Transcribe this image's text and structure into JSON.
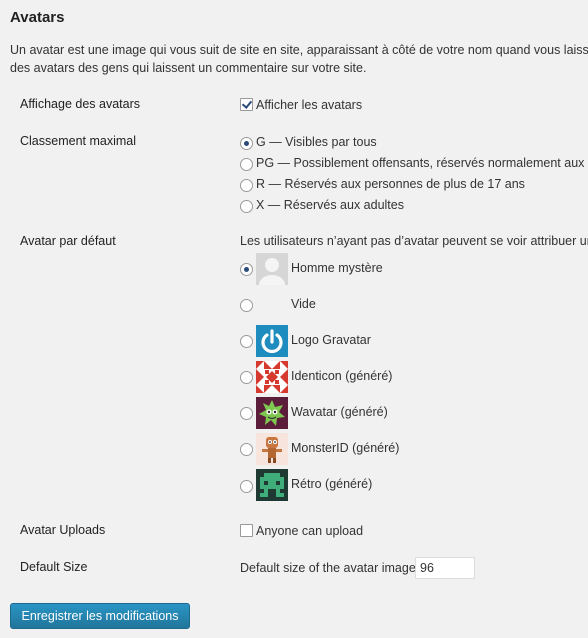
{
  "section_title": "Avatars",
  "description": {
    "line1": "Un avatar est une image qui vous suit de site en site, apparaissant à côté de votre nom quand vous laisse",
    "line2": "des avatars des gens qui laissent un commentaire sur votre site."
  },
  "display": {
    "label": "Affichage des avatars",
    "checkbox_label": "Afficher les avatars",
    "checked": true
  },
  "rating": {
    "label": "Classement maximal",
    "options": [
      {
        "label": "G — Visibles par tous",
        "checked": true
      },
      {
        "label": "PG — Possiblement offensants, réservés normalement aux p",
        "checked": false
      },
      {
        "label": "R — Réservés aux personnes de plus de 17 ans",
        "checked": false
      },
      {
        "label": "X — Réservés aux adultes",
        "checked": false
      }
    ]
  },
  "default_avatar": {
    "label": "Avatar par défaut",
    "intro": "Les utilisateurs n’ayant pas d’avatar peuvent se voir attribuer un",
    "options": [
      {
        "label": "Homme mystère",
        "icon": "mystery-man-avatar",
        "checked": true
      },
      {
        "label": "Vide",
        "icon": "blank-avatar",
        "checked": false
      },
      {
        "label": "Logo Gravatar",
        "icon": "gravatar-logo-avatar",
        "checked": false
      },
      {
        "label": "Identicon (généré)",
        "icon": "identicon-avatar",
        "checked": false
      },
      {
        "label": "Wavatar (généré)",
        "icon": "wavatar-avatar",
        "checked": false
      },
      {
        "label": "MonsterID (généré)",
        "icon": "monsterid-avatar",
        "checked": false
      },
      {
        "label": "Rétro (généré)",
        "icon": "retro-avatar",
        "checked": false
      }
    ]
  },
  "uploads": {
    "label": "Avatar Uploads",
    "checkbox_label": "Anyone can upload",
    "checked": false
  },
  "default_size": {
    "label": "Default Size",
    "field_label": "Default size of the avatar image",
    "value": "96"
  },
  "save_button": "Enregistrer les modifications",
  "colors": {
    "background": "#f1f1f1",
    "button": "#21759b",
    "gravatar_blue": "#1e8cbe"
  }
}
